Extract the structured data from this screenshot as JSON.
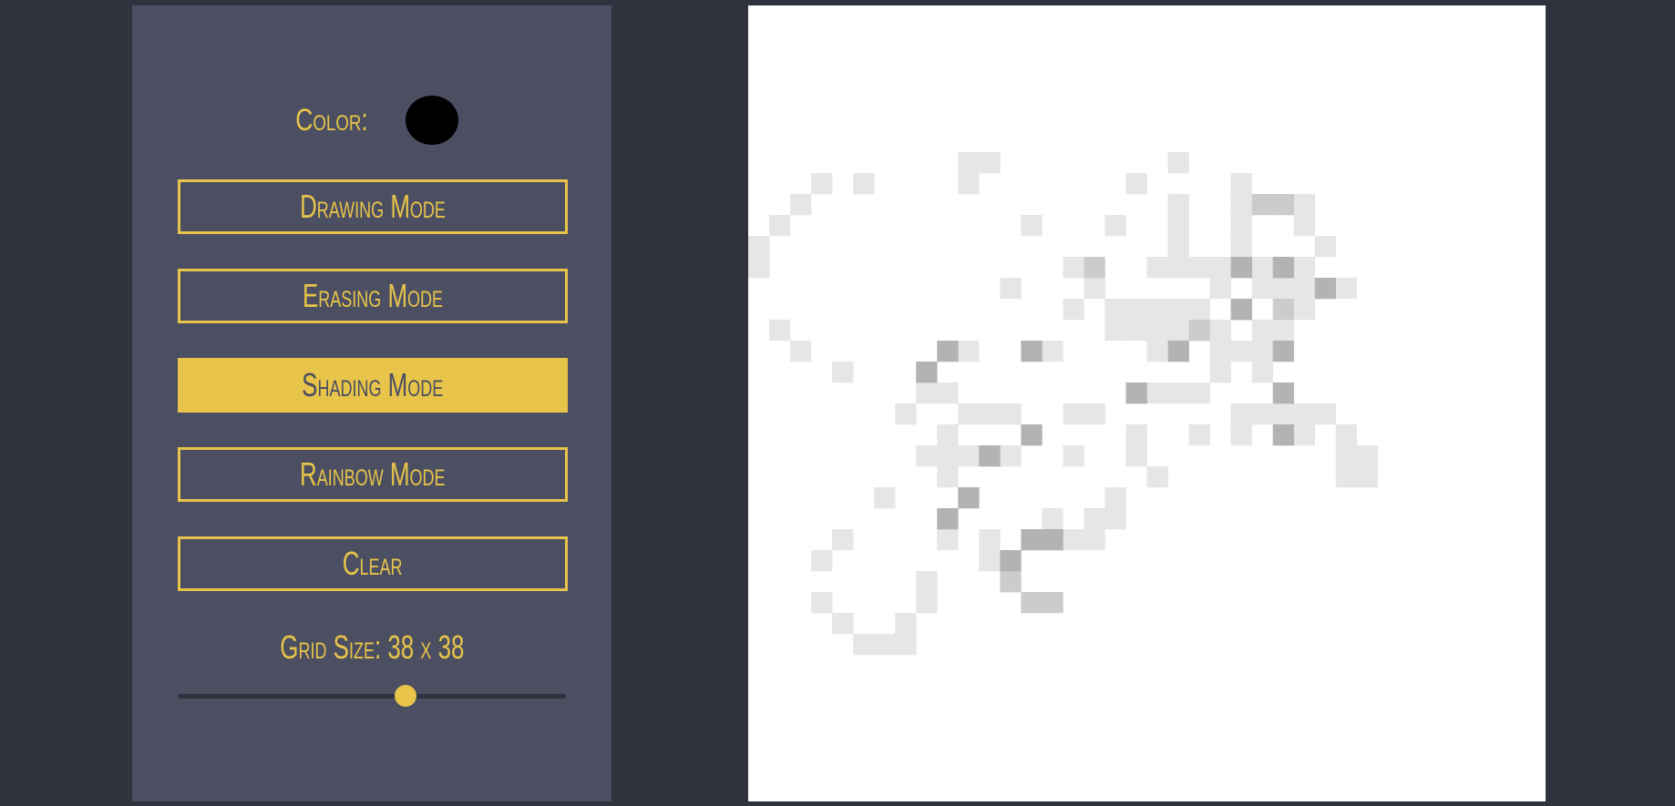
{
  "sidebar": {
    "color_label": "Color:",
    "color_value": "#000000",
    "buttons": [
      {
        "label": "Drawing Mode",
        "active": false
      },
      {
        "label": "Erasing Mode",
        "active": false
      },
      {
        "label": "Shading Mode",
        "active": true
      },
      {
        "label": "Rainbow Mode",
        "active": false
      },
      {
        "label": "Clear",
        "active": false
      }
    ],
    "grid_size_label": "Grid Size: 38 x 38",
    "grid_size": 38,
    "slider_min": 1,
    "slider_max": 64,
    "accent_color": "#e8c44a"
  },
  "canvas": {
    "grid_size": 38,
    "background": "#ffffff",
    "light_shade": "#e6e6e6",
    "mid_shade": "#cccccc",
    "dark_shade": "#b3b3b3",
    "light_cells": [
      [
        10,
        7
      ],
      [
        11,
        7
      ],
      [
        20,
        7
      ],
      [
        3,
        8
      ],
      [
        5,
        8
      ],
      [
        10,
        8
      ],
      [
        18,
        8
      ],
      [
        23,
        8
      ],
      [
        2,
        9
      ],
      [
        20,
        9
      ],
      [
        23,
        9
      ],
      [
        26,
        9
      ],
      [
        1,
        10
      ],
      [
        13,
        10
      ],
      [
        17,
        10
      ],
      [
        20,
        10
      ],
      [
        23,
        10
      ],
      [
        26,
        10
      ],
      [
        0,
        11
      ],
      [
        20,
        11
      ],
      [
        23,
        11
      ],
      [
        27,
        11
      ],
      [
        0,
        12
      ],
      [
        15,
        12
      ],
      [
        19,
        12
      ],
      [
        20,
        12
      ],
      [
        21,
        12
      ],
      [
        22,
        12
      ],
      [
        23,
        12
      ],
      [
        24,
        12
      ],
      [
        26,
        12
      ],
      [
        12,
        13
      ],
      [
        16,
        13
      ],
      [
        22,
        13
      ],
      [
        24,
        13
      ],
      [
        25,
        13
      ],
      [
        26,
        13
      ],
      [
        28,
        13
      ],
      [
        15,
        14
      ],
      [
        17,
        14
      ],
      [
        18,
        14
      ],
      [
        19,
        14
      ],
      [
        20,
        14
      ],
      [
        21,
        14
      ],
      [
        26,
        14
      ],
      [
        1,
        15
      ],
      [
        17,
        15
      ],
      [
        18,
        15
      ],
      [
        19,
        15
      ],
      [
        20,
        15
      ],
      [
        22,
        15
      ],
      [
        24,
        15
      ],
      [
        25,
        15
      ],
      [
        2,
        16
      ],
      [
        10,
        16
      ],
      [
        14,
        16
      ],
      [
        19,
        16
      ],
      [
        22,
        16
      ],
      [
        23,
        16
      ],
      [
        24,
        16
      ],
      [
        4,
        17
      ],
      [
        22,
        17
      ],
      [
        24,
        17
      ],
      [
        8,
        18
      ],
      [
        9,
        18
      ],
      [
        19,
        18
      ],
      [
        20,
        18
      ],
      [
        21,
        18
      ],
      [
        7,
        19
      ],
      [
        10,
        19
      ],
      [
        11,
        19
      ],
      [
        12,
        19
      ],
      [
        15,
        19
      ],
      [
        16,
        19
      ],
      [
        23,
        19
      ],
      [
        24,
        19
      ],
      [
        25,
        19
      ],
      [
        26,
        19
      ],
      [
        27,
        19
      ],
      [
        9,
        20
      ],
      [
        18,
        20
      ],
      [
        21,
        20
      ],
      [
        23,
        20
      ],
      [
        26,
        20
      ],
      [
        28,
        20
      ],
      [
        8,
        21
      ],
      [
        9,
        21
      ],
      [
        10,
        21
      ],
      [
        12,
        21
      ],
      [
        15,
        21
      ],
      [
        18,
        21
      ],
      [
        28,
        21
      ],
      [
        29,
        21
      ],
      [
        9,
        22
      ],
      [
        19,
        22
      ],
      [
        28,
        22
      ],
      [
        29,
        22
      ],
      [
        6,
        23
      ],
      [
        17,
        23
      ],
      [
        14,
        24
      ],
      [
        16,
        24
      ],
      [
        17,
        24
      ],
      [
        4,
        25
      ],
      [
        9,
        25
      ],
      [
        11,
        25
      ],
      [
        15,
        25
      ],
      [
        16,
        25
      ],
      [
        3,
        26
      ],
      [
        11,
        26
      ],
      [
        8,
        27
      ],
      [
        12,
        27
      ],
      [
        3,
        28
      ],
      [
        8,
        28
      ],
      [
        4,
        29
      ],
      [
        7,
        29
      ],
      [
        5,
        30
      ],
      [
        6,
        30
      ],
      [
        7,
        30
      ]
    ],
    "mid_cells": [
      [
        24,
        9
      ],
      [
        25,
        9
      ],
      [
        16,
        12
      ],
      [
        25,
        14
      ],
      [
        21,
        15
      ],
      [
        23,
        14
      ],
      [
        13,
        28
      ],
      [
        14,
        28
      ],
      [
        12,
        27
      ]
    ],
    "dark_cells": [
      [
        25,
        12
      ],
      [
        27,
        13
      ],
      [
        23,
        14
      ],
      [
        9,
        16
      ],
      [
        13,
        16
      ],
      [
        20,
        16
      ],
      [
        8,
        17
      ],
      [
        25,
        16
      ],
      [
        18,
        18
      ],
      [
        25,
        18
      ],
      [
        13,
        20
      ],
      [
        25,
        20
      ],
      [
        11,
        21
      ],
      [
        10,
        23
      ],
      [
        9,
        24
      ],
      [
        13,
        25
      ],
      [
        14,
        25
      ],
      [
        12,
        26
      ],
      [
        23,
        12
      ]
    ]
  }
}
